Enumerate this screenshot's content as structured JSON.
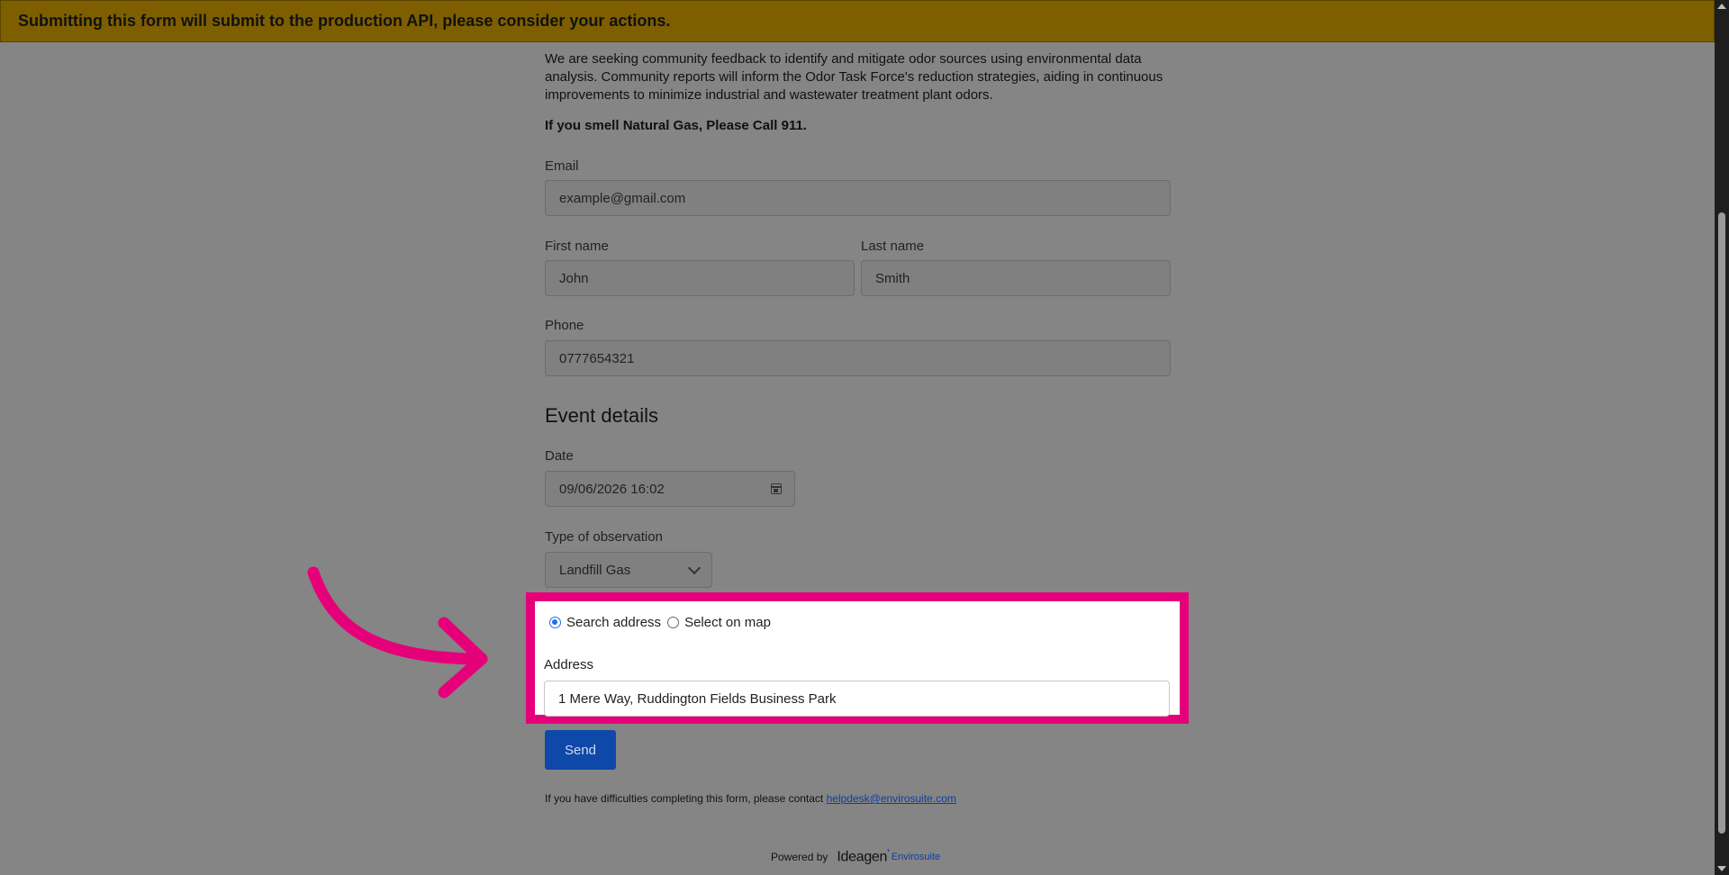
{
  "banner": {
    "text": "Submitting this form will submit to the production API, please consider your actions."
  },
  "intro": {
    "paragraph": "We are seeking community feedback to identify and mitigate odor sources using environmental data analysis. Community reports will inform the Odor Task Force's reduction strategies, aiding in continuous improvements to minimize industrial and wastewater treatment plant odors.",
    "warning": "If you smell Natural Gas, Please Call 911."
  },
  "fields": {
    "email": {
      "label": "Email",
      "value": "example@gmail.com"
    },
    "first_name": {
      "label": "First name",
      "value": "John"
    },
    "last_name": {
      "label": "Last name",
      "value": "Smith"
    },
    "phone": {
      "label": "Phone",
      "value": "0777654321"
    }
  },
  "event": {
    "title": "Event details",
    "date_label": "Date",
    "date_value": "09/06/2026 16:02",
    "type_label": "Type of observation",
    "type_value": "Landfill Gas"
  },
  "location": {
    "option_search": "Search address",
    "option_map": "Select on map",
    "selected": "Search address",
    "address_label": "Address",
    "address_value": "1 Mere Way, Ruddington Fields Business Park"
  },
  "actions": {
    "send_label": "Send"
  },
  "footer": {
    "help_text": "If you have difficulties completing this form, please contact ",
    "help_email": "helpdesk@envirosuite.com",
    "powered_by": "Powered by",
    "logo_main": "Ideagen",
    "logo_sub": "Envirosuite"
  },
  "colors": {
    "banner": "#7e5f00",
    "highlight": "#e5007a",
    "arrow": "#e5007a",
    "button": "#0e48a8",
    "radio_selected": "#1a73e8"
  }
}
